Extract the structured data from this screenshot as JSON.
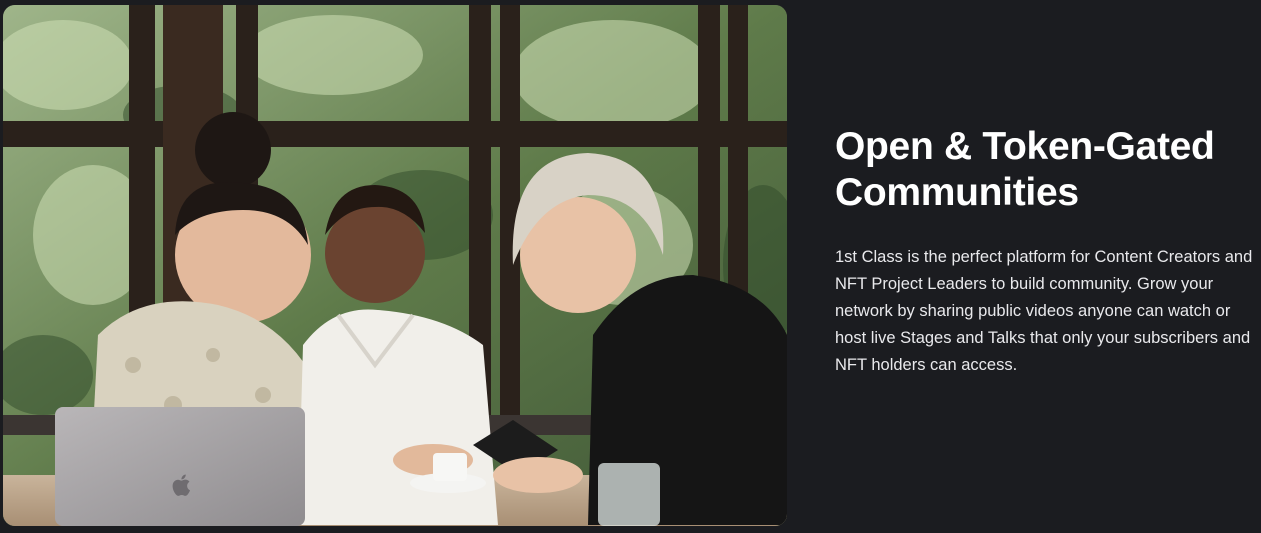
{
  "feature": {
    "title_line1": "Open & Token-Gated",
    "title_line2": "Communities",
    "description": "1st Class is the perfect platform for Content Creators and NFT Project Leaders to build community. Grow your network by sharing public videos anyone can watch or host live Stages and Talks that only your subscribers and NFT holders can access."
  },
  "photo": {
    "icon": "apple-logo-icon"
  },
  "colors": {
    "background": "#1b1c20",
    "heading": "#ffffff",
    "body_text": "#e9e9ec"
  }
}
